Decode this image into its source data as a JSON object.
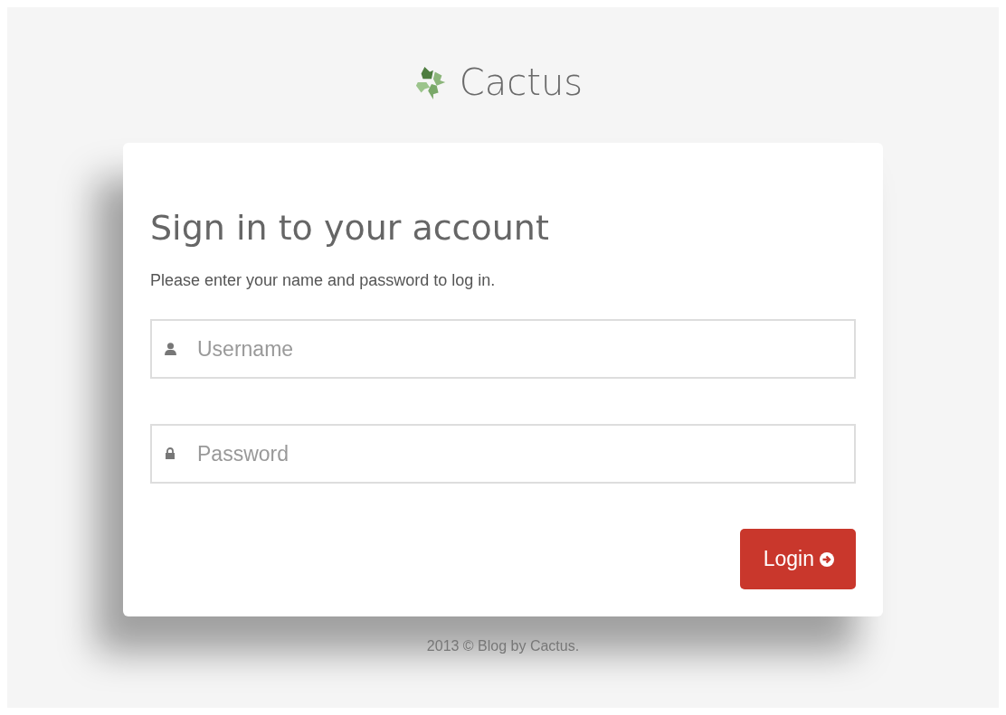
{
  "brand": {
    "name": "Cactus"
  },
  "card": {
    "title": "Sign in to your account",
    "subtitle": "Please enter your name and password to log in."
  },
  "fields": [
    {
      "kind": "user",
      "placeholder": "Username"
    },
    {
      "kind": "password",
      "placeholder": "Password"
    }
  ],
  "button": {
    "label": "Login"
  },
  "footer": "2013 © Blog by Cactus."
}
